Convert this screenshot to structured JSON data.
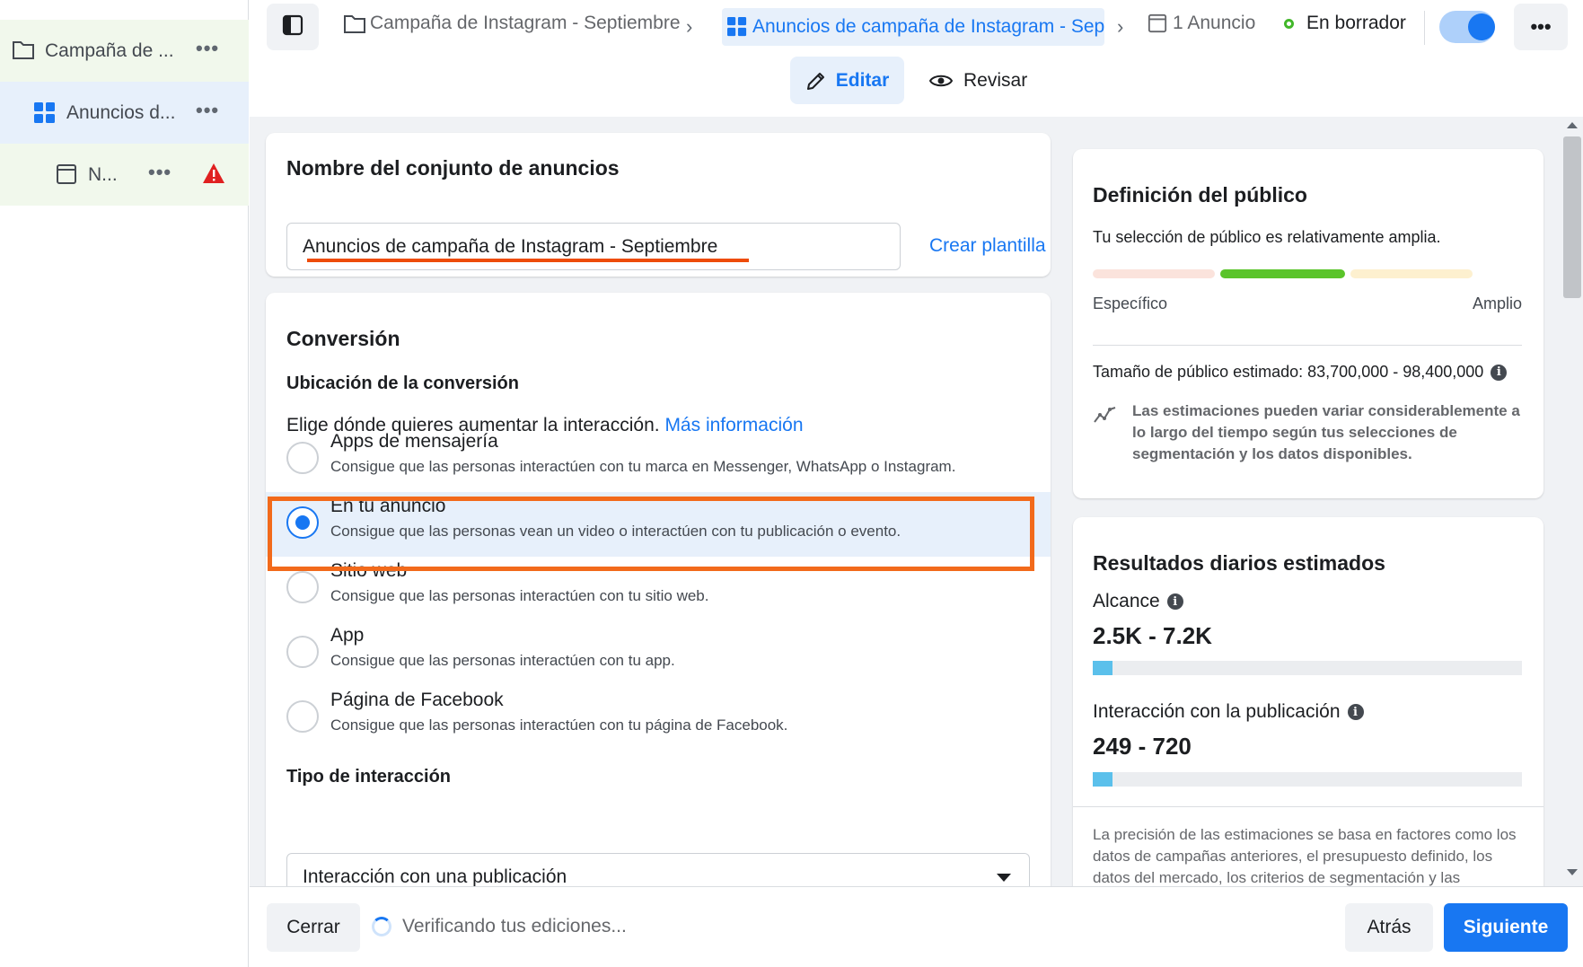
{
  "sidebar": {
    "items": [
      {
        "label": "Campaña de ..."
      },
      {
        "label": "Anuncios d..."
      },
      {
        "label": "N..."
      }
    ],
    "more_glyph": "•••"
  },
  "topbar": {
    "crumbs": [
      {
        "label": "Campaña de Instagram - Septiembre"
      },
      {
        "label": "Anuncios de campaña de Instagram - Septiembre"
      },
      {
        "label": "1 Anuncio"
      }
    ],
    "status": "En borrador",
    "more_glyph": "•••"
  },
  "tabs": {
    "edit": "Editar",
    "review": "Revisar"
  },
  "name_card": {
    "title": "Nombre del conjunto de anuncios",
    "value": "Anuncios de campaña de Instagram - Septiembre",
    "template_link": "Crear plantilla"
  },
  "conversion": {
    "title": "Conversión",
    "location_title": "Ubicación de la conversión",
    "description": "Elige dónde quieres aumentar la interacción.",
    "more_info": "Más información",
    "options": [
      {
        "title": "Apps de mensajería",
        "sub": "Consigue que las personas interactúen con tu marca en Messenger, WhatsApp o Instagram."
      },
      {
        "title": "En tu anuncio",
        "sub": "Consigue que las personas vean un video o interactúen con tu publicación o evento."
      },
      {
        "title": "Sitio web",
        "sub": "Consigue que las personas interactúen con tu sitio web."
      },
      {
        "title": "App",
        "sub": "Consigue que las personas interactúen con tu app."
      },
      {
        "title": "Página de Facebook",
        "sub": "Consigue que las personas interactúen con tu página de Facebook."
      }
    ],
    "selected_index": 1,
    "interaction_title": "Tipo de interacción",
    "interaction_value": "Interacción con una publicación"
  },
  "audience": {
    "title": "Definición del público",
    "note": "Tu selección de público es relativamente amplia.",
    "specific": "Específico",
    "broad": "Amplio",
    "size": "Tamaño de público estimado: 83,700,000 - 98,400,000",
    "warning": "Las estimaciones pueden variar considerablemente a lo largo del tiempo según tus selecciones de segmentación y los datos disponibles."
  },
  "results": {
    "title": "Resultados diarios estimados",
    "reach_label": "Alcance",
    "reach_value": "2.5K - 7.2K",
    "reach_fill": 0.045,
    "engagement_label": "Interacción con la publicación",
    "engagement_value": "249 - 720",
    "engagement_fill": 0.045,
    "footnote": "La precisión de las estimaciones se basa en factores como los datos de campañas anteriores, el presupuesto definido, los datos del mercado, los criterios de segmentación y las"
  },
  "footer": {
    "close": "Cerrar",
    "verifying": "Verificando tus ediciones...",
    "back": "Atrás",
    "next": "Siguiente"
  },
  "colors": {
    "accent": "#1877f2",
    "highlight": "#f26a1b",
    "warning": "#e02020",
    "meter_active": "#5ac42a"
  }
}
